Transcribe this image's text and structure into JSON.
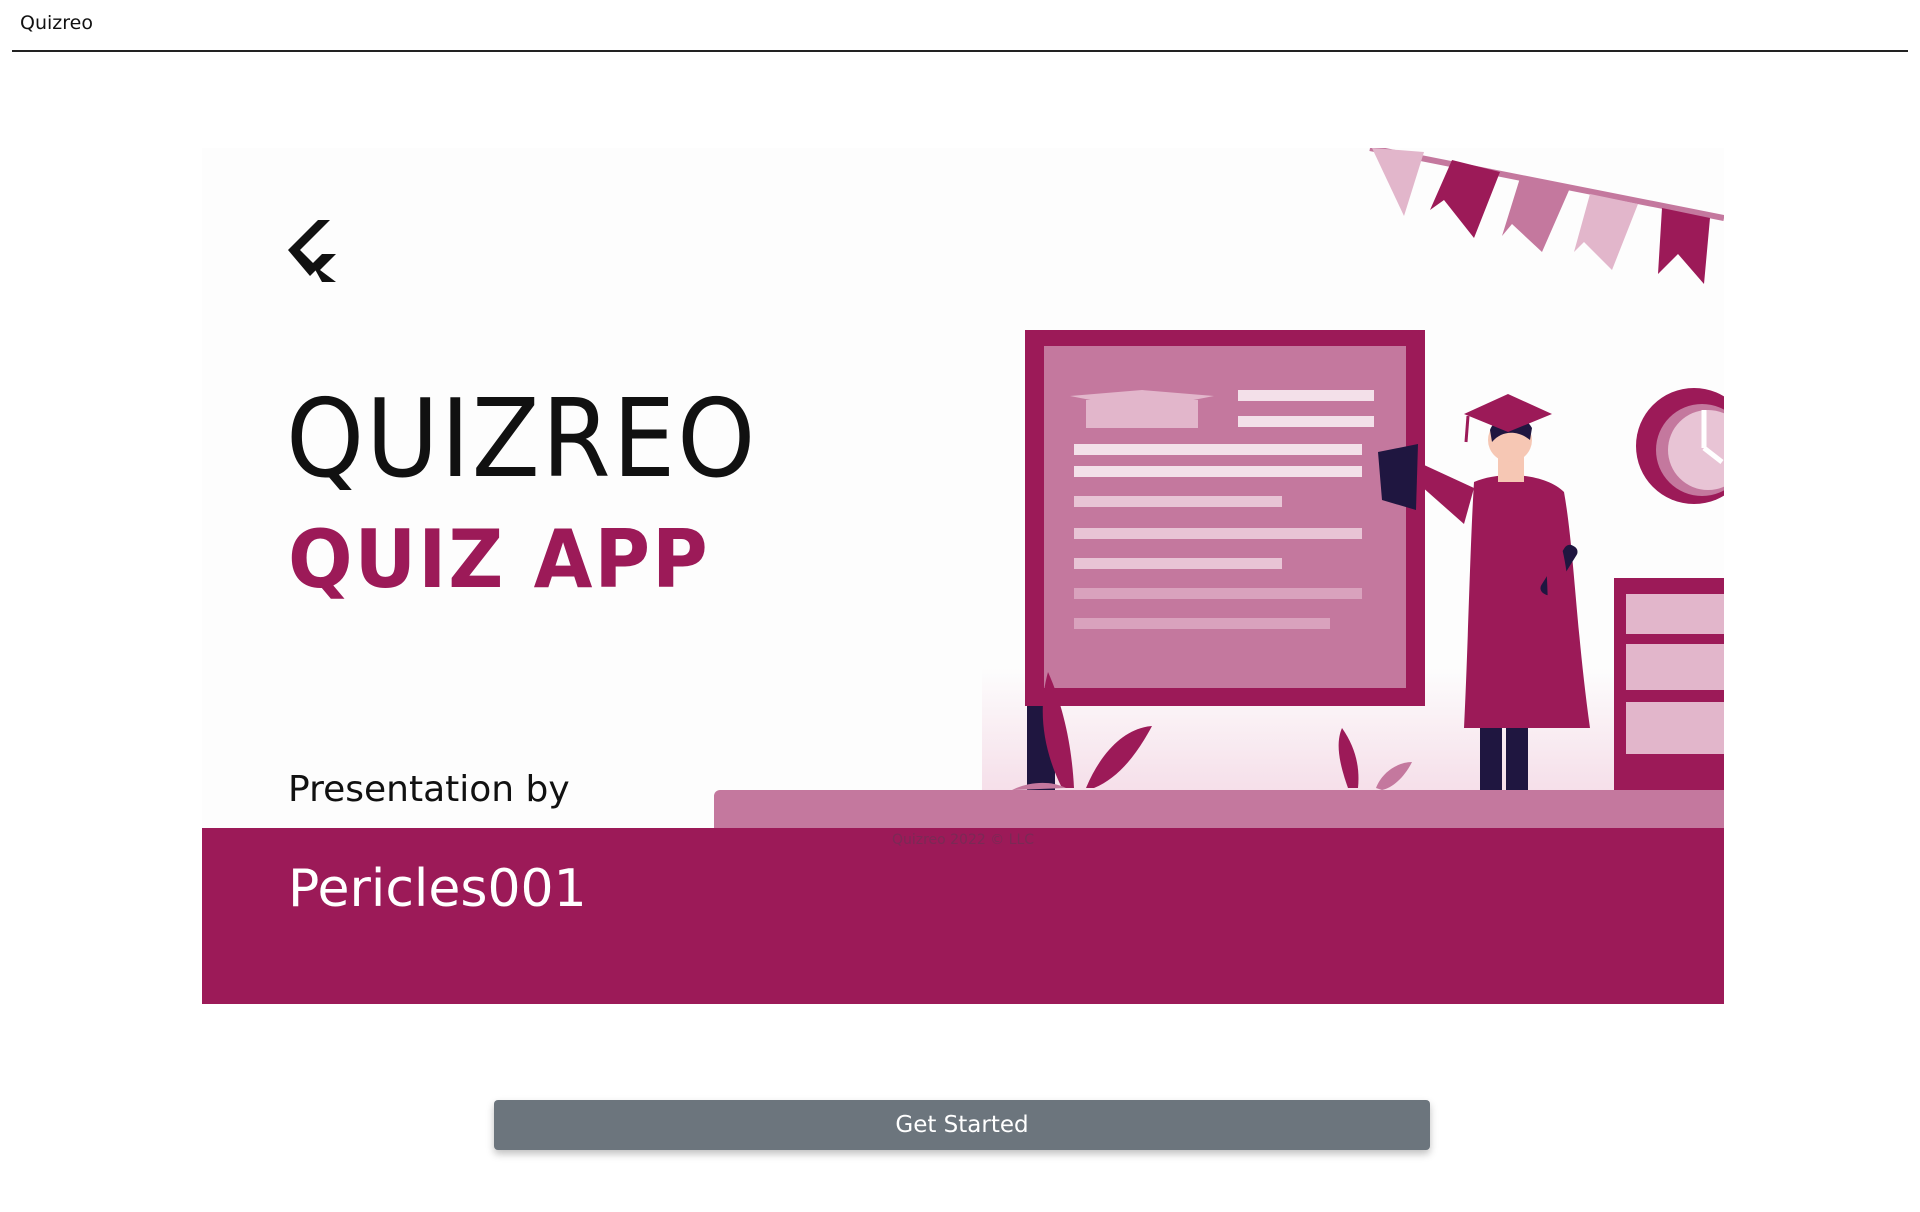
{
  "header": {
    "title": "Quizreo"
  },
  "banner": {
    "heading": "QUIZREO",
    "subheading": "QUIZ APP",
    "presented_label": "Presentation by",
    "author": "Pericles001",
    "copyright": "Quizreo 2022 © LLC",
    "logo": "flutter-logo",
    "colors": {
      "primary": "#9c1a58",
      "secondary": "#c4789e",
      "light": "#e2b6cb",
      "dark": "#1f1640"
    }
  },
  "actions": {
    "get_started_label": "Get Started",
    "button_color": "#6c757d"
  }
}
